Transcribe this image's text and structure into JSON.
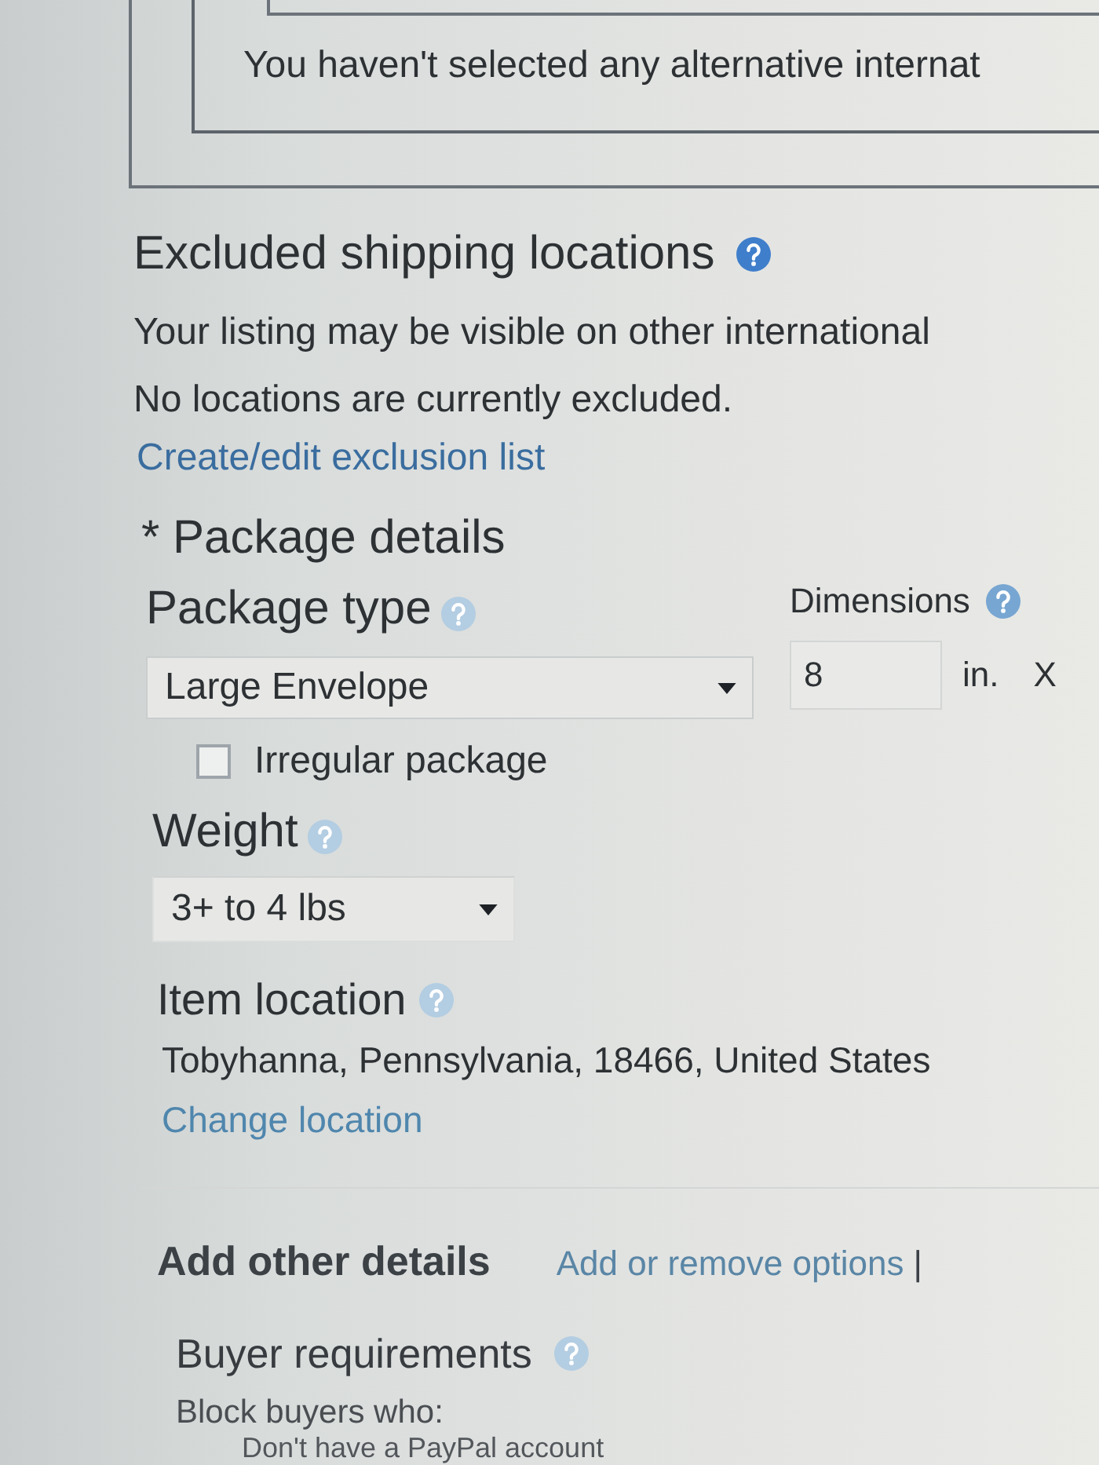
{
  "alternative_shipping": {
    "message": "You haven't selected any alternative internat"
  },
  "excluded_locations": {
    "title": "Excluded shipping locations",
    "note": "Your listing may be visible on other international",
    "status": "No locations are currently excluded.",
    "link": "Create/edit exclusion list"
  },
  "package_details": {
    "title": "* Package details",
    "package_type": {
      "label": "Package type",
      "value": "Large Envelope"
    },
    "irregular_package": {
      "label": "Irregular package",
      "checked": false
    },
    "dimensions": {
      "label": "Dimensions",
      "length": "8",
      "unit": "in.",
      "separator": "X"
    },
    "weight": {
      "label": "Weight",
      "value": "3+ to 4 lbs"
    }
  },
  "item_location": {
    "title": "Item location",
    "address": "Tobyhanna, Pennsylvania, 18466, United States",
    "link": "Change location"
  },
  "other_details": {
    "title": "Add other details",
    "link": "Add or remove options",
    "separator": "|"
  },
  "buyer_requirements": {
    "title": "Buyer requirements",
    "intro": "Block buyers who:",
    "items": [
      "Don't have a PayPal account"
    ]
  }
}
